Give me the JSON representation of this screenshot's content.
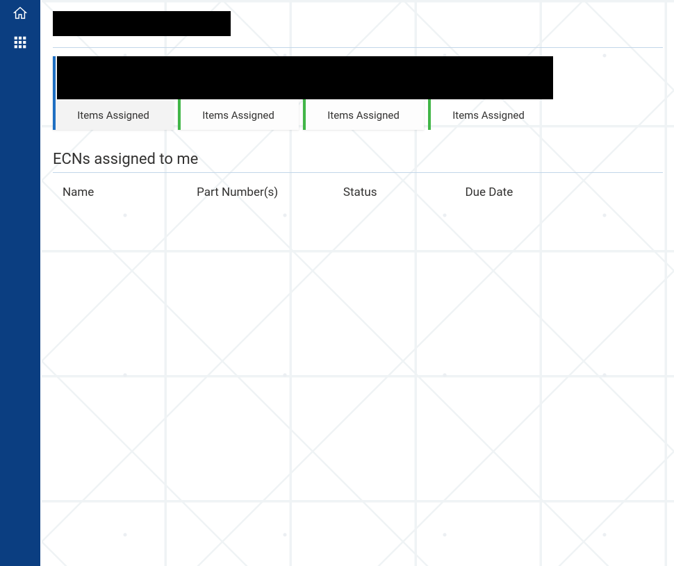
{
  "sidebar": {
    "home_icon": "home",
    "apps_icon": "apps"
  },
  "tiles": [
    {
      "label": "Items Assigned",
      "active": true,
      "accent": "#1f6fc2"
    },
    {
      "label": "Items Assigned",
      "active": false,
      "accent": "#42b648"
    },
    {
      "label": "Items Assigned",
      "active": false,
      "accent": "#42b648"
    },
    {
      "label": "Items Assigned",
      "active": false,
      "accent": "#42b648"
    }
  ],
  "section": {
    "heading": "ECNs assigned to me"
  },
  "table": {
    "columns": [
      "Name",
      "Part Number(s)",
      "Status",
      "Due Date"
    ],
    "rows": []
  }
}
